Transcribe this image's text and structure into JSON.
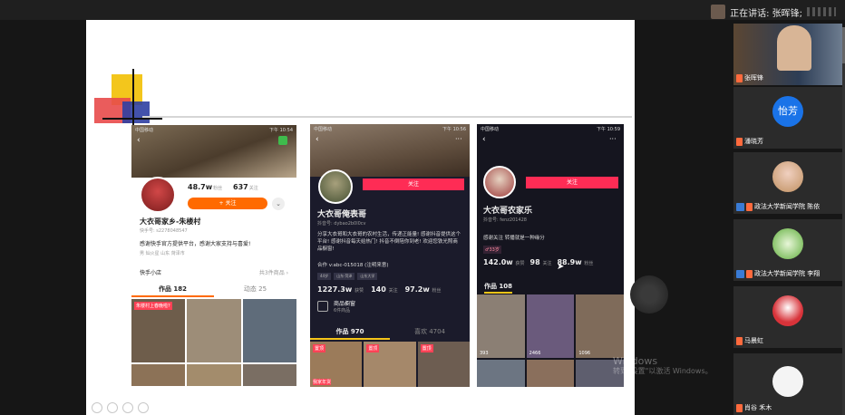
{
  "header": {
    "speaking_text": "正在讲话: 张晖锋;"
  },
  "phone1": {
    "status_left": "中国移动",
    "status_time": "下午 10:54",
    "followers": "48.7w",
    "followers_label": "粉丝",
    "following": "637",
    "following_label": "关注",
    "follow_btn": "+ 关注",
    "name": "大衣哥家乡-朱楼村",
    "id": "快手号: s2278048547",
    "bio": "感谢快手官方提供平台，感谢大家支持与喜爱!",
    "tags": "男   灿火星   山东 菏泽市",
    "shop": "快手小店",
    "shop_right": "共3件商品 ›",
    "tab1": "作品 182",
    "tab2": "动态 25",
    "video_tag": "朱楼村上春晚啦?"
  },
  "phone2": {
    "status_left": "中国移动",
    "status_time": "下午 10:56",
    "follow_btn": "关注",
    "name": "大衣哥俺表哥",
    "id": "抖音号: dybao2b0l0cv",
    "bio": "分享大衣哥和大衣哥的农村生活，传递正能量! 感谢抖音提供这个平台! 感谢抖音每天给热门! 抖音不倒陪你到老! 欢迎您铁光照商品橱窗!",
    "contact": "合作 v:abc-015018 (注明来意)",
    "chips": [
      "44岁",
      "山东·菏泽",
      "山东大学"
    ],
    "stat1": "1227.3w",
    "stat1_label": "获赞",
    "stat2": "140",
    "stat2_label": "关注",
    "stat3": "97.2w",
    "stat3_label": "粉丝",
    "window_title": "商品橱窗",
    "window_sub": "6件商品",
    "tab1": "作品 970",
    "tab2": "喜欢 4704",
    "video_tags": [
      "置顶",
      "置顶",
      "置顶"
    ],
    "video_caption": "我家年货"
  },
  "phone3": {
    "status_left": "中国移动",
    "status_time": "下午 10:59",
    "follow_btn": "关注",
    "name": "大衣哥农家乐",
    "id": "抖音号: fenz201428",
    "bio": "感谢关注  转播就是一种缘分",
    "age": "♂33岁",
    "stat1": "142.0w",
    "stat1_label": "获赞",
    "stat2": "98",
    "stat2_label": "关注",
    "stat3": "88.9w",
    "stat3_label": "粉丝",
    "tab1": "作品 108",
    "counts": [
      "393",
      "2466",
      "1096"
    ]
  },
  "watermark": {
    "line1": "Windows",
    "line2": "转到\"设置\"以激活 Windows。"
  },
  "participants": [
    {
      "name": "张晖锋"
    },
    {
      "name": "潘晓芳",
      "avatar_text": "怡芳"
    },
    {
      "name": "政法大学新闻学院 陈依"
    },
    {
      "name": "政法大学新闻学院 李翔"
    },
    {
      "name": "马晨虹"
    },
    {
      "name": "肖谷 禾木"
    }
  ],
  "colors": {
    "orange": "#ff6a00",
    "douyin_red": "#fe2c55",
    "blue_avatar": "#1a73e8"
  }
}
